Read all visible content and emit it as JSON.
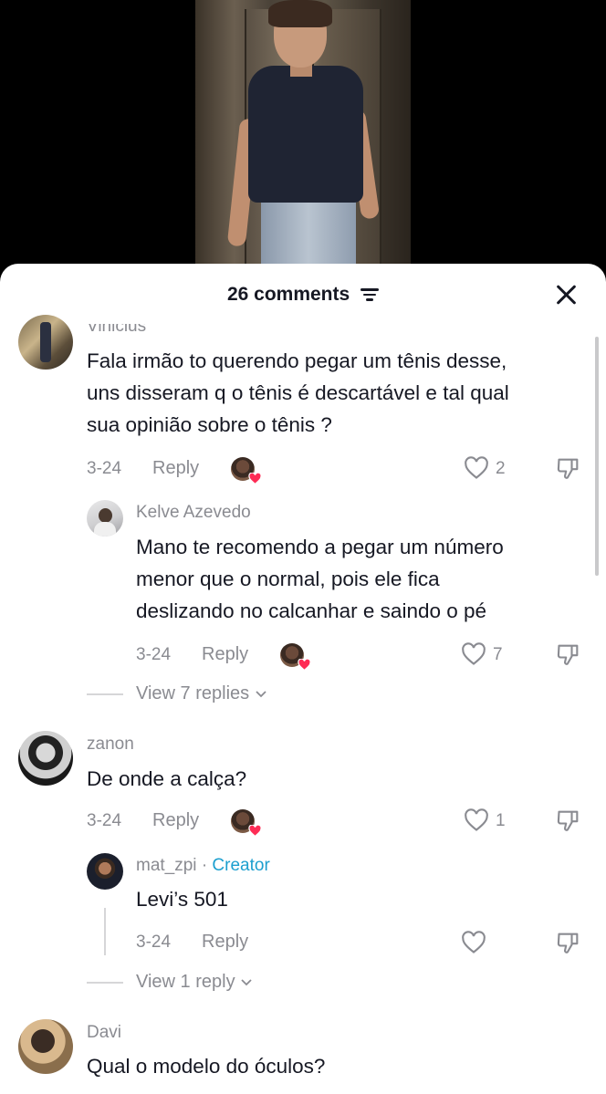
{
  "sheet": {
    "comment_count_label": "26 comments"
  },
  "comments": [
    {
      "username": "Vinicius",
      "text_lines": [
        "Fala irmão to querendo pegar um tênis desse,",
        "uns disseram q o tênis é descartável e tal qual",
        "sua opinião sobre o tênis ?"
      ],
      "date": "3-24",
      "reply_label": "Reply",
      "likes": "2"
    },
    {
      "username": "Kelve Azevedo",
      "text_lines": [
        "Mano te recomendo a pegar um número",
        "menor que o normal, pois ele fica",
        "deslizando no calcanhar e saindo o pé"
      ],
      "date": "3-24",
      "reply_label": "Reply",
      "likes": "7",
      "view_replies": "View 7 replies"
    },
    {
      "username": "zanon",
      "text_lines": [
        "De onde a calça?"
      ],
      "date": "3-24",
      "reply_label": "Reply",
      "likes": "1"
    },
    {
      "username": "mat_zpi",
      "creator_separator": "·",
      "creator_badge": "Creator",
      "text_lines": [
        "Levi’s 501"
      ],
      "date": "3-24",
      "reply_label": "Reply",
      "view_replies": "View 1 reply"
    },
    {
      "username": "Davi",
      "text_lines": [
        "Qual o modelo do óculos?"
      ]
    }
  ],
  "icons": {
    "close": "close-icon",
    "filter": "filter-icon",
    "like": "heart-outline-icon",
    "dislike": "thumbs-down-icon",
    "chevron": "chevron-down-icon"
  },
  "colors": {
    "creator": "#1c9fcf",
    "heart_badge": "#fe2c55",
    "muted_text": "#8a8b91"
  }
}
